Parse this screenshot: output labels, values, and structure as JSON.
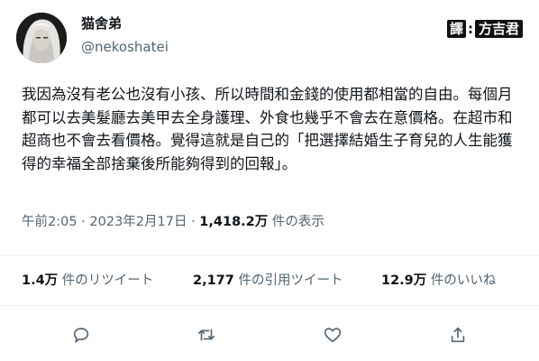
{
  "author": {
    "display_name": "猫舍弟",
    "handle": "@nekoshatei",
    "avatar_icon": "profile-photo"
  },
  "watermark": {
    "tag": "譯",
    "separator": ":",
    "translator": "方吉君"
  },
  "tweet": {
    "text": "我因為沒有老公也沒有小孩、所以時間和金錢的使用都相當的自由。每個月都可以去美髮廳去美甲去全身護理、外食也幾乎不會去在意價格。在超市和超商也不會去看價格。覺得這就是自己的「把選擇結婚生子育兒的人生能獲得的幸福全部捨棄後所能夠得到的回報」。"
  },
  "meta": {
    "time": "午前2:05",
    "dot1": " · ",
    "date": "2023年2月17日",
    "dot2": " · ",
    "views_count": "1,418.2万",
    "views_label": " 件の表示"
  },
  "stats": {
    "retweets_count": "1.4万",
    "retweets_label": " 件のリツイート",
    "quotes_count": "2,177",
    "quotes_label": " 件の引用ツイート",
    "likes_count": "12.9万",
    "likes_label": " 件のいいね"
  },
  "actions": [
    "reply-icon",
    "retweet-icon",
    "like-icon",
    "share-icon"
  ],
  "colors": {
    "text_primary": "#0f1419",
    "text_secondary": "#536471",
    "divider": "#eff3f4"
  }
}
